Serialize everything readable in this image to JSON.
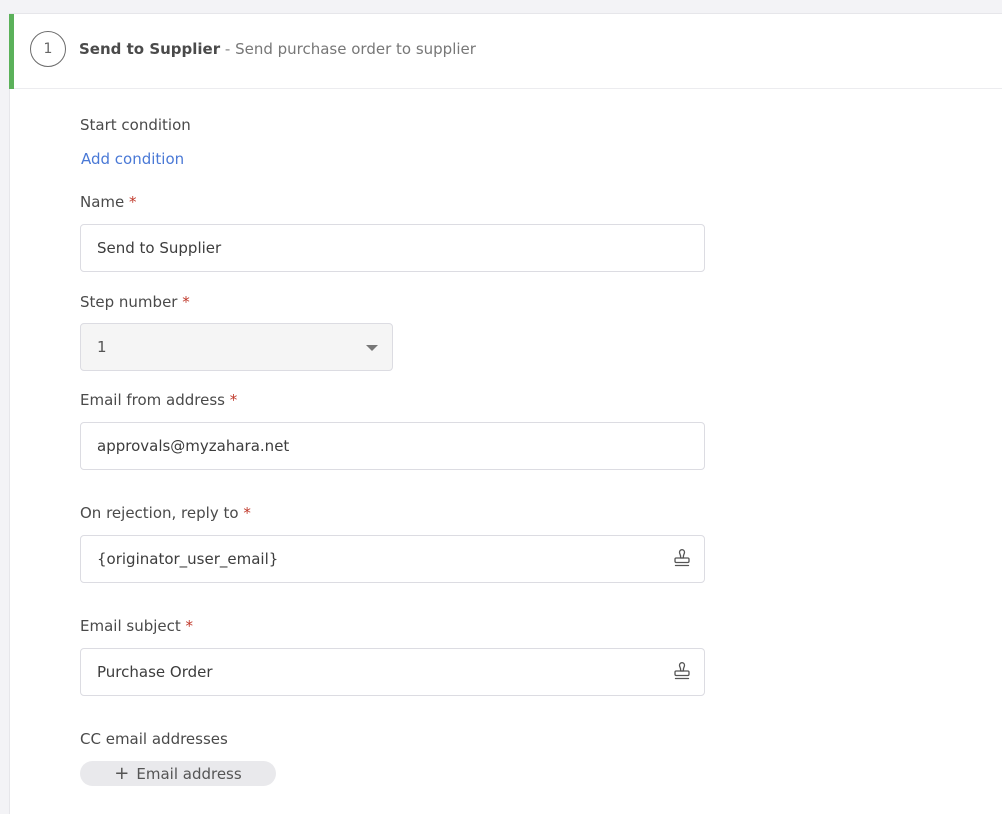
{
  "step": {
    "number": "1",
    "name": "Send to Supplier",
    "separator": " - ",
    "description": "Send purchase order to supplier",
    "accent_color": "#5bb15a"
  },
  "start_condition": {
    "label": "Start condition",
    "add_link": "Add condition"
  },
  "form": {
    "required_marker": "*",
    "name": {
      "label": "Name",
      "value": "Send to Supplier"
    },
    "step_number": {
      "label": "Step number",
      "value": "1"
    },
    "email_from": {
      "label": "Email from address",
      "value": "approvals@myzahara.net"
    },
    "reply_to": {
      "label": "On rejection, reply to",
      "value": "{originator_user_email}",
      "icon": "stamp-icon"
    },
    "email_subject": {
      "label": "Email subject",
      "value": "Purchase Order",
      "icon": "stamp-icon"
    },
    "cc": {
      "label": "CC email addresses",
      "add_button": "Email address",
      "add_icon": "plus-icon"
    }
  },
  "colors": {
    "link": "#4a79d6",
    "required": "#c0392b"
  }
}
